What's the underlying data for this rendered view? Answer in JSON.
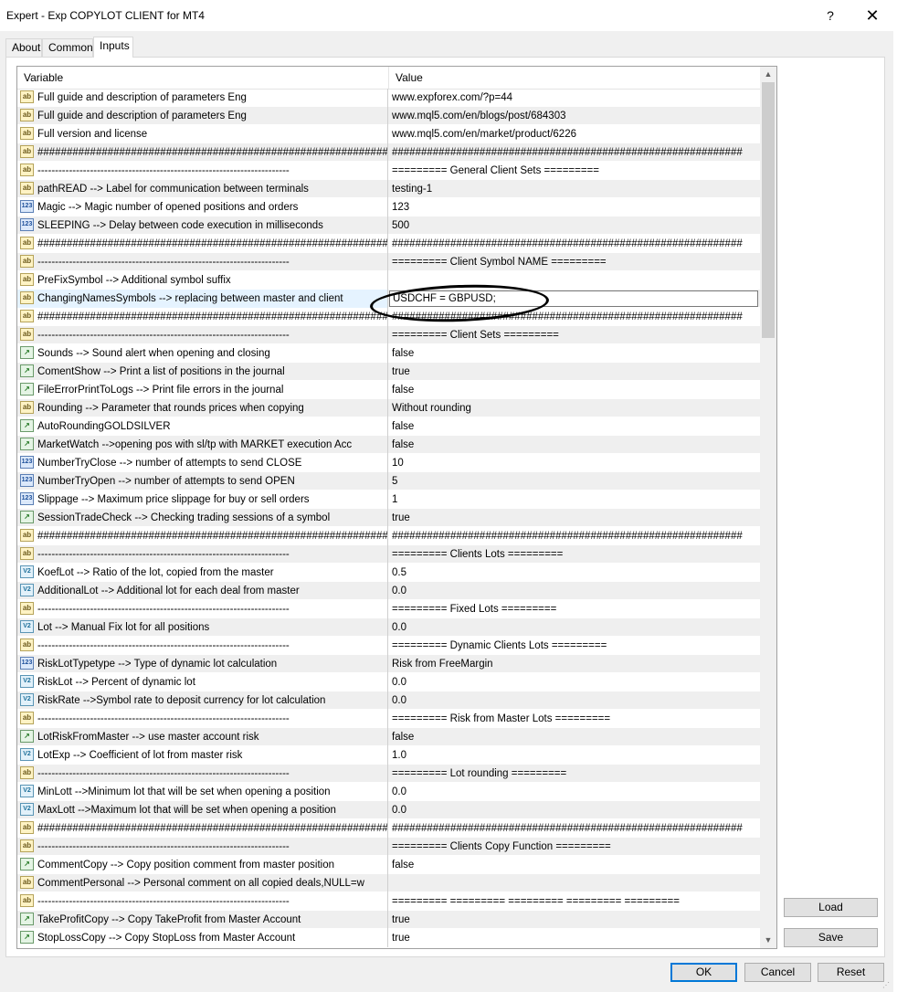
{
  "window": {
    "title": "Expert - Exp COPYLOT CLIENT for MT4",
    "help_label": "?",
    "close_label": "✕"
  },
  "tabs": [
    {
      "label": "About",
      "active": false
    },
    {
      "label": "Common",
      "active": false
    },
    {
      "label": "Inputs",
      "active": true
    }
  ],
  "grid": {
    "header": {
      "variable": "Variable",
      "value": "Value"
    },
    "rows": [
      {
        "icon": "ab",
        "variable": "Full guide and description of parameters Eng",
        "value": "www.expforex.com/?p=44"
      },
      {
        "icon": "ab",
        "variable": "Full guide and description of parameters Eng",
        "value": "www.mql5.com/en/blogs/post/684303"
      },
      {
        "icon": "ab",
        "variable": "Full version and license",
        "value": "www.mql5.com/en/market/product/6226"
      },
      {
        "icon": "ab",
        "variable": "############################################################",
        "value": "############################################################"
      },
      {
        "icon": "ab",
        "variable": "------------------------------------------------------------------------",
        "value": "=========  General Client Sets  ========="
      },
      {
        "icon": "ab",
        "variable": "pathREAD --> Label for communication between terminals",
        "value": "testing-1"
      },
      {
        "icon": "123",
        "variable": "Magic --> Magic number of opened positions and orders",
        "value": "123"
      },
      {
        "icon": "123",
        "variable": "SLEEPING --> Delay between code execution in milliseconds",
        "value": "500"
      },
      {
        "icon": "ab",
        "variable": "############################################################",
        "value": "############################################################"
      },
      {
        "icon": "ab",
        "variable": "------------------------------------------------------------------------",
        "value": "=========  Client Symbol NAME  ========="
      },
      {
        "icon": "ab",
        "variable": "PreFixSymbol --> Additional symbol suffix",
        "value": ""
      },
      {
        "icon": "ab",
        "variable": "ChangingNamesSymbols --> replacing between master and client",
        "value": "USDCHF = GBPUSD;",
        "editing": true
      },
      {
        "icon": "ab",
        "variable": "############################################################",
        "value": "############################################################"
      },
      {
        "icon": "ab",
        "variable": "------------------------------------------------------------------------",
        "value": "=========  Client Sets  ========="
      },
      {
        "icon": "bool",
        "variable": "Sounds --> Sound alert when opening and closing",
        "value": "false"
      },
      {
        "icon": "bool",
        "variable": "ComentShow --> Print a list of positions in the journal",
        "value": "true"
      },
      {
        "icon": "bool",
        "variable": "FileErrorPrintToLogs --> Print file errors in the journal",
        "value": "false"
      },
      {
        "icon": "ab",
        "variable": "Rounding --> Parameter that rounds prices when copying",
        "value": "Without rounding"
      },
      {
        "icon": "bool",
        "variable": "AutoRoundingGOLDSILVER",
        "value": "false"
      },
      {
        "icon": "bool",
        "variable": "MarketWatch -->opening pos with sl/tp with MARKET execution Acc",
        "value": "false"
      },
      {
        "icon": "123",
        "variable": "NumberTryClose --> number of attempts to send CLOSE",
        "value": "10"
      },
      {
        "icon": "123",
        "variable": "NumberTryOpen --> number of attempts to send OPEN",
        "value": "5"
      },
      {
        "icon": "123",
        "variable": "Slippage --> Maximum price slippage for buy or sell orders",
        "value": "1"
      },
      {
        "icon": "bool",
        "variable": "SessionTradeCheck --> Checking trading sessions of a symbol",
        "value": "true"
      },
      {
        "icon": "ab",
        "variable": "############################################################",
        "value": "############################################################"
      },
      {
        "icon": "ab",
        "variable": "------------------------------------------------------------------------",
        "value": "=========  Clients Lots  ========="
      },
      {
        "icon": "v2",
        "variable": "KoefLot --> Ratio of the lot, copied from the master",
        "value": "0.5"
      },
      {
        "icon": "v2",
        "variable": "AdditionalLot --> Additional lot for each deal from master",
        "value": "0.0"
      },
      {
        "icon": "ab",
        "variable": "------------------------------------------------------------------------",
        "value": "=========  Fixed Lots  ========="
      },
      {
        "icon": "v2",
        "variable": "Lot --> Manual Fix lot for all positions",
        "value": "0.0"
      },
      {
        "icon": "ab",
        "variable": "------------------------------------------------------------------------",
        "value": "=========  Dynamic Clients Lots  ========="
      },
      {
        "icon": "123",
        "variable": "RiskLotTypetype --> Type of dynamic lot calculation",
        "value": "Risk from FreeMargin"
      },
      {
        "icon": "v2",
        "variable": "RiskLot --> Percent of dynamic lot",
        "value": "0.0"
      },
      {
        "icon": "v2",
        "variable": "RiskRate -->Symbol rate to deposit currency for lot calculation",
        "value": "0.0"
      },
      {
        "icon": "ab",
        "variable": "------------------------------------------------------------------------",
        "value": "=========  Risk from Master Lots  ========="
      },
      {
        "icon": "bool",
        "variable": "LotRiskFromMaster --> use master account risk",
        "value": "false"
      },
      {
        "icon": "v2",
        "variable": "LotExp --> Coefficient of lot from master risk",
        "value": "1.0"
      },
      {
        "icon": "ab",
        "variable": "------------------------------------------------------------------------",
        "value": "=========  Lot rounding  ========="
      },
      {
        "icon": "v2",
        "variable": "MinLott -->Minimum lot that will be set when opening a position",
        "value": "0.0"
      },
      {
        "icon": "v2",
        "variable": "MaxLott -->Maximum lot that will be set when opening a position",
        "value": "0.0"
      },
      {
        "icon": "ab",
        "variable": "############################################################",
        "value": "############################################################"
      },
      {
        "icon": "ab",
        "variable": "------------------------------------------------------------------------",
        "value": "=========  Clients Copy Function  ========="
      },
      {
        "icon": "bool",
        "variable": "CommentCopy --> Copy position comment from master position",
        "value": "false"
      },
      {
        "icon": "ab",
        "variable": "CommentPersonal --> Personal comment on all copied deals,NULL=w",
        "value": ""
      },
      {
        "icon": "ab",
        "variable": "------------------------------------------------------------------------",
        "value": "========= ========= ========= ========= ========="
      },
      {
        "icon": "bool",
        "variable": "TakeProfitCopy --> Copy TakeProfit from Master Account",
        "value": "true"
      },
      {
        "icon": "bool",
        "variable": "StopLossCopy --> Copy StopLoss from Master Account",
        "value": "true"
      }
    ]
  },
  "scrollbar": {
    "up_label": "▲",
    "down_label": "▼"
  },
  "buttons": {
    "load": "Load",
    "save": "Save",
    "ok": "OK",
    "cancel": "Cancel",
    "reset": "Reset"
  },
  "icons": {
    "ab": "ab",
    "123": "123",
    "bool": "↗",
    "v2": "V2"
  }
}
